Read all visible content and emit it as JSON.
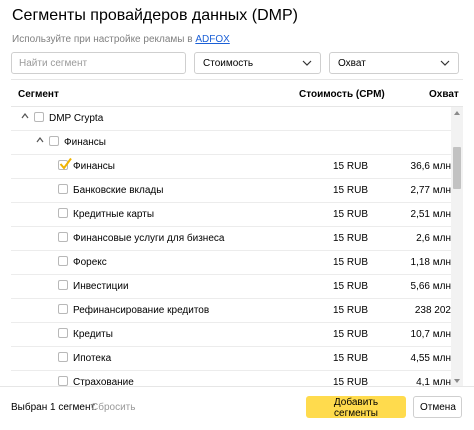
{
  "dialog": {
    "title": "Сегменты провайдеров данных (DMP)",
    "subtitle_text": "Используйте при настройке рекламы в",
    "subtitle_link": "ADFOX"
  },
  "filters": {
    "search_placeholder": "Найти сегмент",
    "cost_label": "Стоимость",
    "reach_label": "Охват"
  },
  "table": {
    "headers": {
      "segment": "Сегмент",
      "cost": "Стоимость (CPM)",
      "reach": "Охват"
    },
    "rows": [
      {
        "name": "DMP Crypta",
        "cost": "",
        "reach": "",
        "level": 0,
        "expandable": true,
        "checked": false
      },
      {
        "name": "Финансы",
        "cost": "",
        "reach": "",
        "level": 1,
        "expandable": true,
        "checked": false
      },
      {
        "name": "Финансы",
        "cost": "15 RUB",
        "reach": "36,6 млн",
        "level": 2,
        "expandable": false,
        "checked": true
      },
      {
        "name": "Банковские вклады",
        "cost": "15 RUB",
        "reach": "2,77 млн",
        "level": 2,
        "expandable": false,
        "checked": false
      },
      {
        "name": "Кредитные карты",
        "cost": "15 RUB",
        "reach": "2,51 млн",
        "level": 2,
        "expandable": false,
        "checked": false
      },
      {
        "name": "Финансовые услуги для бизнеса",
        "cost": "15 RUB",
        "reach": "2,6 млн",
        "level": 2,
        "expandable": false,
        "checked": false
      },
      {
        "name": "Форекс",
        "cost": "15 RUB",
        "reach": "1,18 млн",
        "level": 2,
        "expandable": false,
        "checked": false
      },
      {
        "name": "Инвестиции",
        "cost": "15 RUB",
        "reach": "5,66 млн",
        "level": 2,
        "expandable": false,
        "checked": false
      },
      {
        "name": "Рефинансирование кредитов",
        "cost": "15 RUB",
        "reach": "238 202",
        "level": 2,
        "expandable": false,
        "checked": false
      },
      {
        "name": "Кредиты",
        "cost": "15 RUB",
        "reach": "10,7 млн",
        "level": 2,
        "expandable": false,
        "checked": false
      },
      {
        "name": "Ипотека",
        "cost": "15 RUB",
        "reach": "4,55 млн",
        "level": 2,
        "expandable": false,
        "checked": false
      },
      {
        "name": "Страхование",
        "cost": "15 RUB",
        "reach": "4,1 млн",
        "level": 2,
        "expandable": false,
        "checked": false
      }
    ]
  },
  "footer": {
    "selected_text": "Выбран 1 сегмент.",
    "reset_label": "Сбросить",
    "add_button": "Добавить сегменты",
    "cancel_button": "Отмена"
  },
  "colors": {
    "accent_button": "#ffdb4d",
    "link": "#1a5fd6",
    "check": "#f0b400"
  }
}
